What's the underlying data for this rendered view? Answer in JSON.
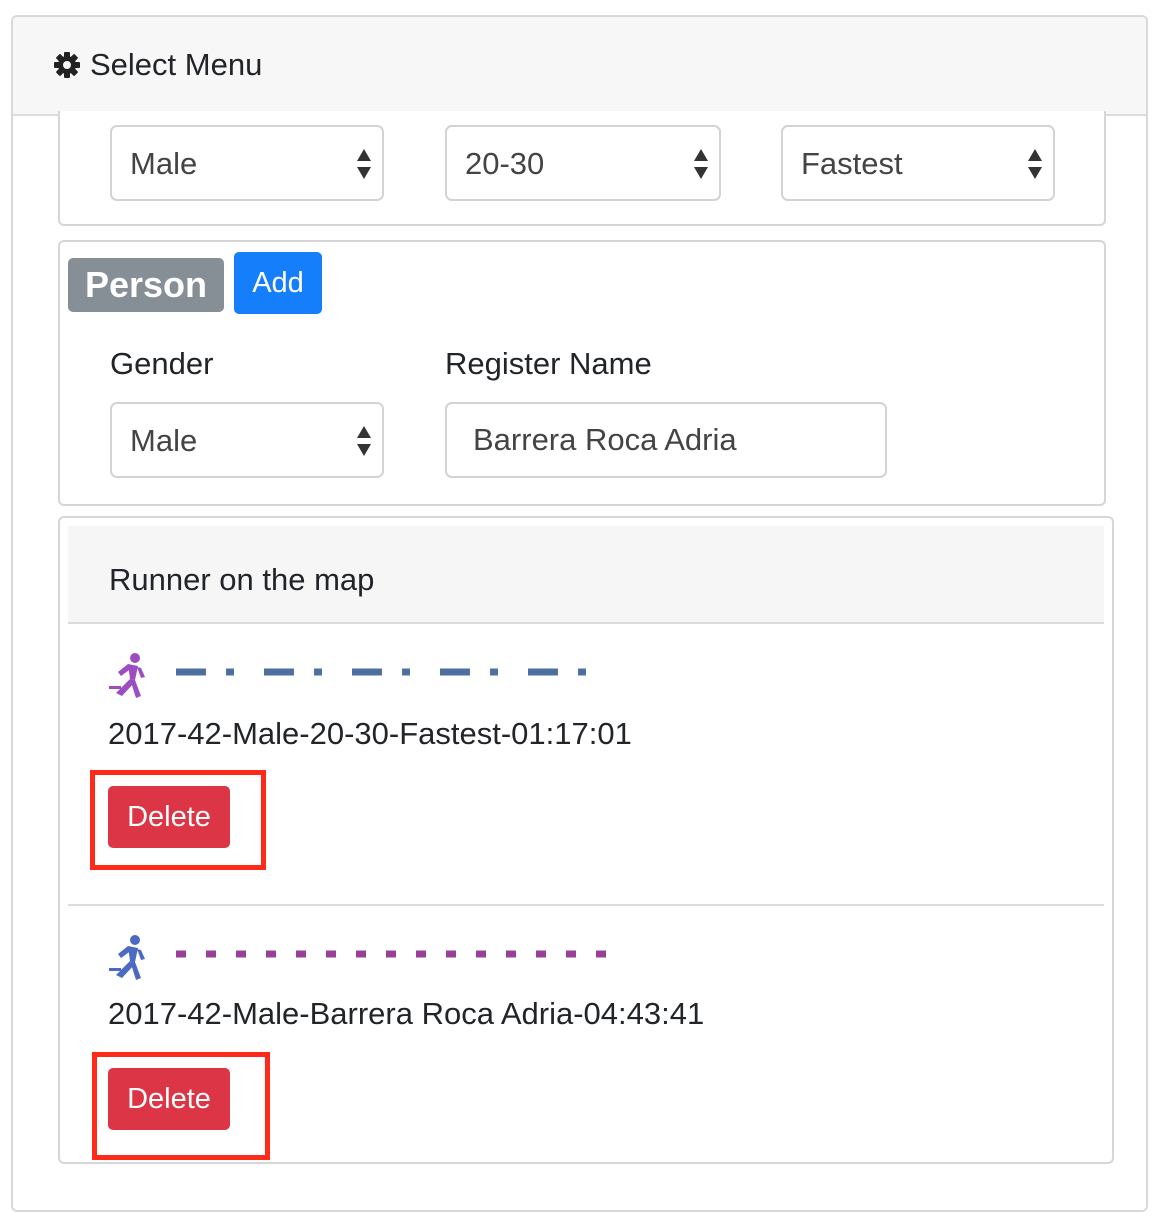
{
  "header": {
    "title": "Select Menu",
    "icon": "gear-icon"
  },
  "filters": {
    "gender": "Male",
    "age_group": "20-30",
    "sort": "Fastest"
  },
  "person": {
    "badge": "Person",
    "add_label": "Add",
    "gender_label": "Gender",
    "gender_value": "Male",
    "register_label": "Register Name",
    "register_value": "Barrera Roca Adria"
  },
  "runners": {
    "title": "Runner on the map",
    "items": [
      {
        "name": "2017-42-Male-20-30-Fastest-01:17:01",
        "delete_label": "Delete",
        "icon_color": "#9c4ec0",
        "line_color": "#4e6fa0",
        "line_style": "dash-dot"
      },
      {
        "name": "2017-42-Male-Barrera Roca Adria-04:43:41",
        "delete_label": "Delete",
        "icon_color": "#4c6ac2",
        "line_color": "#9a3f98",
        "line_style": "dotted"
      }
    ]
  }
}
